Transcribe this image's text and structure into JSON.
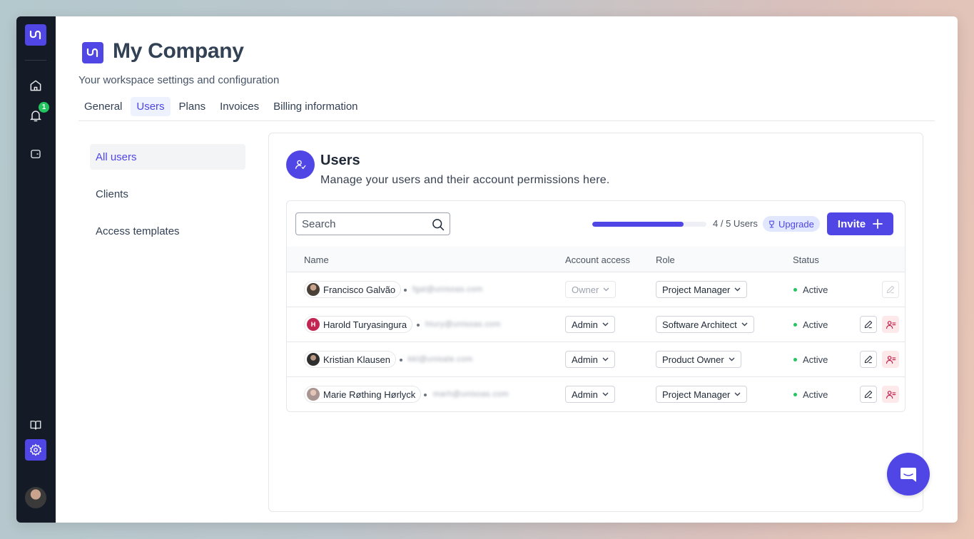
{
  "sidebar": {
    "notification_count": "1",
    "icons": [
      "logo-icon",
      "home-icon",
      "bell-icon",
      "wallet-icon",
      "book-icon",
      "gear-icon"
    ]
  },
  "header": {
    "title": "My Company",
    "subtitle": "Your workspace settings and configuration"
  },
  "tabs": [
    {
      "label": "General"
    },
    {
      "label": "Users",
      "active": true
    },
    {
      "label": "Plans"
    },
    {
      "label": "Invoices"
    },
    {
      "label": "Billing information"
    }
  ],
  "subnav": [
    {
      "label": "All users",
      "active": true
    },
    {
      "label": "Clients"
    },
    {
      "label": "Access templates"
    }
  ],
  "panel": {
    "title": "Users",
    "description": "Manage your users and their account permissions here."
  },
  "toolbar": {
    "search_placeholder": "Search",
    "usage_fraction": 0.8,
    "users_count": "4 / 5 Users",
    "upgrade_label": "Upgrade",
    "invite_label": "Invite"
  },
  "table": {
    "headers": {
      "name": "Name",
      "access": "Account access",
      "role": "Role",
      "status": "Status"
    },
    "rows": [
      {
        "name": "Francisco Galvão",
        "email": "fgal@unisoas.com",
        "access": "Owner",
        "role": "Project Manager",
        "status": "Active",
        "avatar_color": "#5a4a42"
      },
      {
        "name": "Harold Turyasingura",
        "email": "htury@unisoas.com",
        "access": "Admin",
        "role": "Software Architect",
        "status": "Active",
        "avatar_initial": "H",
        "avatar_color": "#c02651"
      },
      {
        "name": "Kristian Klausen",
        "email": "kkl@unisale.com",
        "access": "Admin",
        "role": "Product Owner",
        "status": "Active",
        "avatar_color": "#3b3b3b"
      },
      {
        "name": "Marie Røthing Hørlyck",
        "email": "marh@unisoas.com",
        "access": "Admin",
        "role": "Project Manager",
        "status": "Active",
        "avatar_color": "#c9b0a8"
      }
    ]
  },
  "colors": {
    "accent": "#4f46e5",
    "sidebar_bg": "#151b26",
    "status_active": "#22c55e",
    "danger_bg": "#fde8ea"
  }
}
